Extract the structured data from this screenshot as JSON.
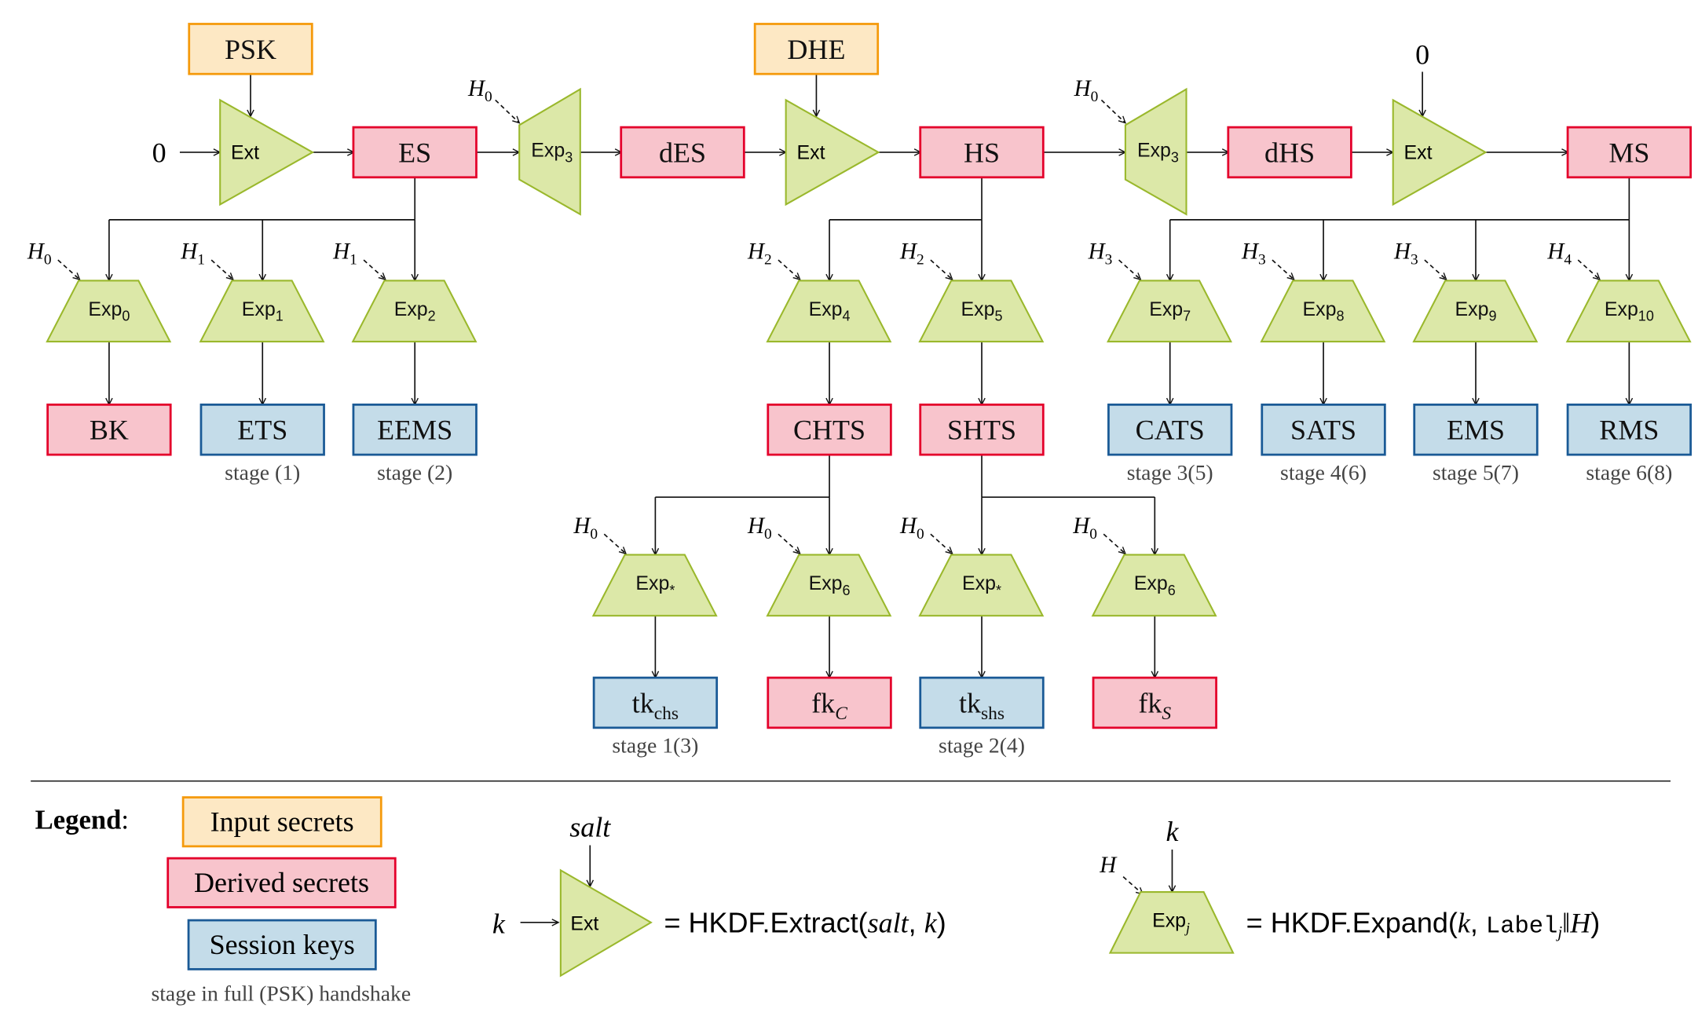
{
  "colors": {
    "input": {
      "fill": "#fde8c4",
      "stroke": "#f59a0c"
    },
    "derived": {
      "fill": "#f8c4cc",
      "stroke": "#e4002b"
    },
    "session": {
      "fill": "#c4dce9",
      "stroke": "#1a5a96"
    },
    "function": {
      "fill": "#dce8a8",
      "stroke": "#9ab82c"
    }
  },
  "nodes": [
    {
      "id": "psk",
      "label": "PSK",
      "kind": "input"
    },
    {
      "id": "dhe",
      "label": "DHE",
      "kind": "input"
    },
    {
      "id": "es",
      "label": "ES",
      "kind": "derived"
    },
    {
      "id": "des",
      "label": "dES",
      "kind": "derived"
    },
    {
      "id": "hs",
      "label": "HS",
      "kind": "derived"
    },
    {
      "id": "dhs",
      "label": "dHS",
      "kind": "derived"
    },
    {
      "id": "ms",
      "label": "MS",
      "kind": "derived"
    },
    {
      "id": "bk",
      "label": "BK",
      "kind": "derived"
    },
    {
      "id": "ets",
      "label": "ETS",
      "kind": "session",
      "stage": "stage (1)"
    },
    {
      "id": "eems",
      "label": "EEMS",
      "kind": "session",
      "stage": "stage (2)"
    },
    {
      "id": "chts",
      "label": "CHTS",
      "kind": "derived"
    },
    {
      "id": "shts",
      "label": "SHTS",
      "kind": "derived"
    },
    {
      "id": "cats",
      "label": "CATS",
      "kind": "session",
      "stage": "stage 3(5)"
    },
    {
      "id": "sats",
      "label": "SATS",
      "kind": "session",
      "stage": "stage 4(6)"
    },
    {
      "id": "ems",
      "label": "EMS",
      "kind": "session",
      "stage": "stage 5(7)"
    },
    {
      "id": "rms",
      "label": "RMS",
      "kind": "session",
      "stage": "stage 6(8)"
    },
    {
      "id": "tkchs",
      "label": "tk",
      "sub": "chs",
      "kind": "session",
      "stage": "stage 1(3)"
    },
    {
      "id": "fkc",
      "label": "fk",
      "sub": "C",
      "sub_italic": true,
      "kind": "derived"
    },
    {
      "id": "tkshs",
      "label": "tk",
      "sub": "shs",
      "kind": "session",
      "stage": "stage 2(4)"
    },
    {
      "id": "fks",
      "label": "fk",
      "sub": "S",
      "sub_italic": true,
      "kind": "derived"
    }
  ],
  "constants": [
    {
      "id": "zero_left",
      "label": "0"
    },
    {
      "id": "zero_right",
      "label": "0"
    }
  ],
  "functions": [
    {
      "id": "ext1",
      "type": "extract",
      "label": "Ext"
    },
    {
      "id": "ext2",
      "type": "extract",
      "label": "Ext"
    },
    {
      "id": "ext3",
      "type": "extract",
      "label": "Ext"
    },
    {
      "id": "exp3a",
      "type": "expand",
      "label": "Exp",
      "sub": "3",
      "hash": "H",
      "hash_sub": "0"
    },
    {
      "id": "exp3b",
      "type": "expand",
      "label": "Exp",
      "sub": "3",
      "hash": "H",
      "hash_sub": "0"
    },
    {
      "id": "exp0",
      "type": "expand",
      "label": "Exp",
      "sub": "0",
      "hash": "H",
      "hash_sub": "0"
    },
    {
      "id": "exp1",
      "type": "expand",
      "label": "Exp",
      "sub": "1",
      "hash": "H",
      "hash_sub": "1"
    },
    {
      "id": "exp2",
      "type": "expand",
      "label": "Exp",
      "sub": "2",
      "hash": "H",
      "hash_sub": "1"
    },
    {
      "id": "exp4",
      "type": "expand",
      "label": "Exp",
      "sub": "4",
      "hash": "H",
      "hash_sub": "2"
    },
    {
      "id": "exp5",
      "type": "expand",
      "label": "Exp",
      "sub": "5",
      "hash": "H",
      "hash_sub": "2"
    },
    {
      "id": "exp7",
      "type": "expand",
      "label": "Exp",
      "sub": "7",
      "hash": "H",
      "hash_sub": "3"
    },
    {
      "id": "exp8",
      "type": "expand",
      "label": "Exp",
      "sub": "8",
      "hash": "H",
      "hash_sub": "3"
    },
    {
      "id": "exp9",
      "type": "expand",
      "label": "Exp",
      "sub": "9",
      "hash": "H",
      "hash_sub": "3"
    },
    {
      "id": "exp10",
      "type": "expand",
      "label": "Exp",
      "sub": "10",
      "hash": "H",
      "hash_sub": "4"
    },
    {
      "id": "expstar_c",
      "type": "expand",
      "label": "Exp",
      "sub": "*",
      "hash": "H",
      "hash_sub": "0"
    },
    {
      "id": "exp6_c",
      "type": "expand",
      "label": "Exp",
      "sub": "6",
      "hash": "H",
      "hash_sub": "0"
    },
    {
      "id": "expstar_s",
      "type": "expand",
      "label": "Exp",
      "sub": "*",
      "hash": "H",
      "hash_sub": "0"
    },
    {
      "id": "exp6_s",
      "type": "expand",
      "label": "Exp",
      "sub": "6",
      "hash": "H",
      "hash_sub": "0"
    }
  ],
  "legend": {
    "title": "Legend",
    "colon": ":",
    "input": "Input secrets",
    "derived": "Derived secrets",
    "session": "Session keys",
    "stage_note": "stage in full (PSK) handshake",
    "extract": {
      "ext_label": "Ext",
      "salt": "salt",
      "key": "k",
      "prefix": "= HKDF.Extract(",
      "arg1": "salt",
      "sep": ", ",
      "arg2": "k",
      "suffix": ")"
    },
    "expand": {
      "exp_label": "Exp",
      "exp_sub": "j",
      "key": "k",
      "hash": "H",
      "prefix": "= HKDF.Expand(",
      "arg1": "k",
      "sep": ", ",
      "label": "Label",
      "label_sub": "j",
      "concat": "‖",
      "arg2": "H",
      "suffix": ")"
    }
  }
}
